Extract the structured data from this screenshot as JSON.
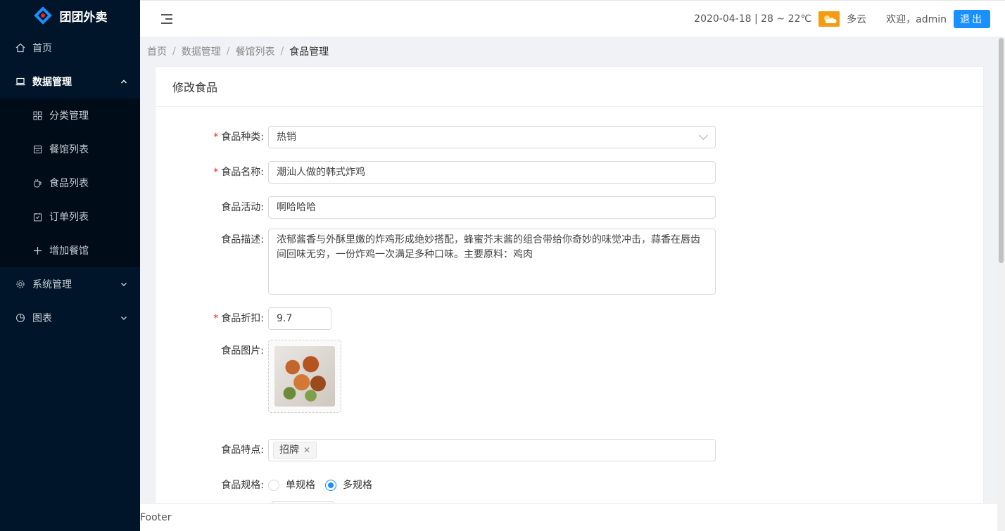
{
  "app": {
    "logo_text": "团团外卖"
  },
  "sidebar": {
    "items": [
      {
        "label": "首页",
        "icon": "home-icon"
      },
      {
        "label": "数据管理",
        "icon": "laptop-icon",
        "expanded": true,
        "children": [
          {
            "label": "分类管理",
            "icon": "grid-icon"
          },
          {
            "label": "餐馆列表",
            "icon": "store-icon"
          },
          {
            "label": "食品列表",
            "icon": "cup-icon"
          },
          {
            "label": "订单列表",
            "icon": "order-icon"
          },
          {
            "label": "增加餐馆",
            "icon": "plus-icon"
          }
        ]
      },
      {
        "label": "系统管理",
        "icon": "gear-icon"
      },
      {
        "label": "图表",
        "icon": "pie-chart-icon"
      }
    ]
  },
  "header": {
    "date_weather": "2020-04-18 | 28 ~ 22℃",
    "weather_icon": "partly-cloudy-icon",
    "weather_text": "多云",
    "welcome": "欢迎，admin",
    "logout_label": "退出"
  },
  "breadcrumb": [
    "首页",
    "数据管理",
    "餐馆列表",
    "食品管理"
  ],
  "card": {
    "title": "修改食品"
  },
  "form": {
    "category": {
      "label": "食品种类:",
      "value": "热销",
      "required": true
    },
    "name": {
      "label": "食品名称:",
      "value": "潮汕人做的韩式炸鸡",
      "required": true
    },
    "activity": {
      "label": "食品活动:",
      "value": "啊哈哈哈"
    },
    "description": {
      "label": "食品描述:",
      "value": "浓郁酱香与外酥里嫩的炸鸡形成绝妙搭配，蜂蜜芥末酱的组合带给你奇妙的味觉冲击，蒜香在唇齿间回味无穷，一份炸鸡一次满足多种口味。主要原料：鸡肉"
    },
    "discount": {
      "label": "食品折扣:",
      "value": "9.7",
      "required": true
    },
    "image": {
      "label": "食品图片:"
    },
    "features": {
      "label": "食品特点:",
      "tags": [
        "招牌"
      ]
    },
    "spec": {
      "label": "食品规格:",
      "options": [
        "单规格",
        "多规格"
      ],
      "selected": "多规格"
    }
  },
  "footer": {
    "text": "Footer"
  },
  "colors": {
    "sidebar_bg": "#001529",
    "primary": "#1890ff",
    "required": "#f5222d"
  }
}
